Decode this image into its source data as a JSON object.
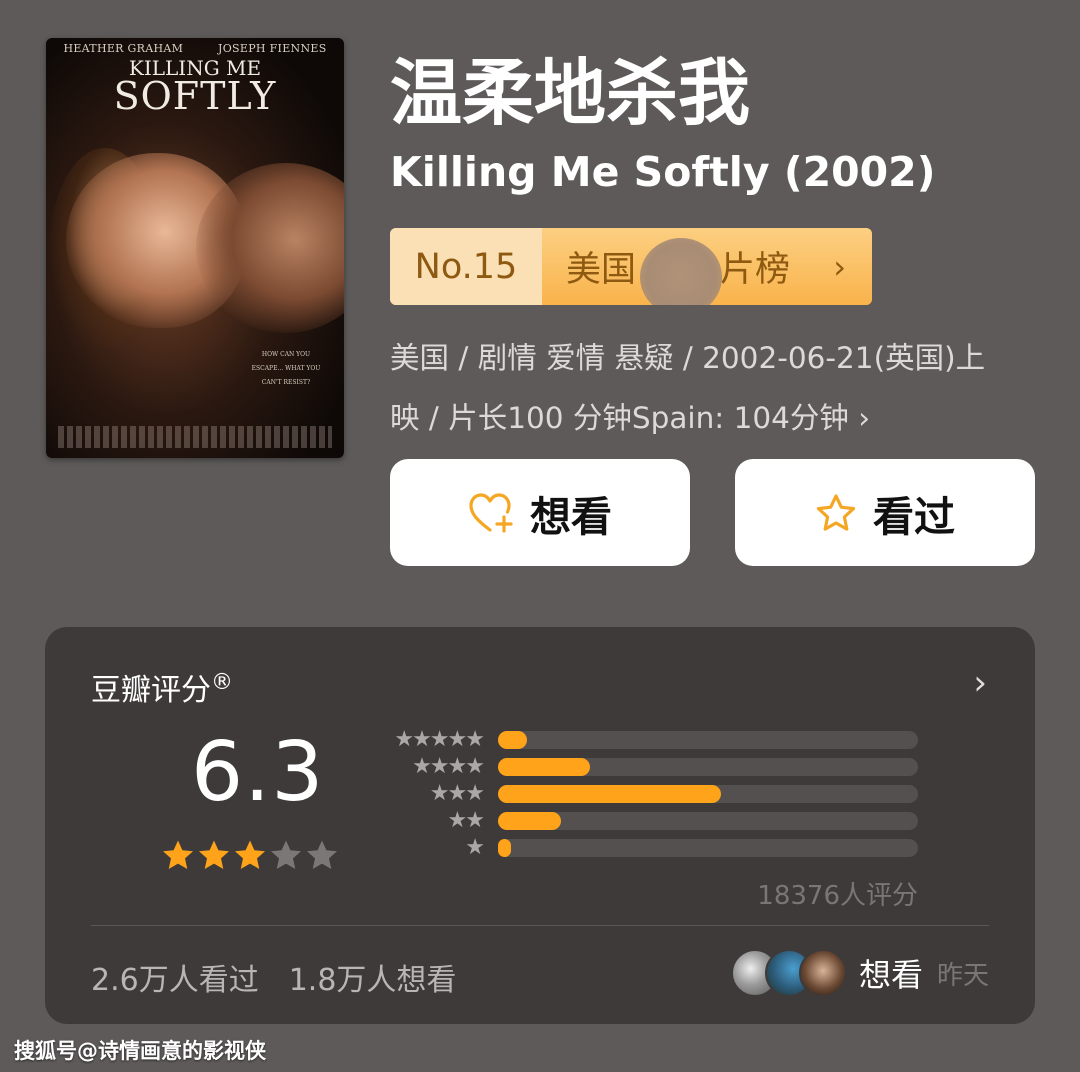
{
  "poster": {
    "actor_left": "HEATHER GRAHAM",
    "actor_right": "JOSEPH FIENNES",
    "title_line1": "KILLING ME",
    "title_line2": "SOFTLY",
    "tagline": "HOW CAN YOU ESCAPE... WHAT YOU CAN'T RESIST?"
  },
  "movie": {
    "title_cn": "温柔地杀我",
    "title_en": "Killing Me Softly (2002)",
    "rank_no": "No.15",
    "rank_list_visible": "美国",
    "rank_list_suffix": "片榜",
    "meta_line1": "美国 / 剧情 爱情 悬疑 / 2002-06-21(英国)上",
    "meta_line2": "映 / 片长100 分钟Spain: 104分钟 ›"
  },
  "actions": {
    "want_label": "想看",
    "seen_label": "看过"
  },
  "rating": {
    "section_title": "豆瓣评分",
    "registered_mark": "®",
    "score": "6.3",
    "stars_filled": 3,
    "stars_total": 5,
    "distribution": [
      {
        "stars": 5,
        "fraction": 0.07
      },
      {
        "stars": 4,
        "fraction": 0.22
      },
      {
        "stars": 3,
        "fraction": 0.53
      },
      {
        "stars": 2,
        "fraction": 0.15
      },
      {
        "stars": 1,
        "fraction": 0.03
      }
    ],
    "rating_count": "18376人评分",
    "watched_count": "2.6万人看过",
    "want_count": "1.8万人想看",
    "friend_action": "想看",
    "friend_time": "昨天"
  },
  "colors": {
    "accent": "#ffa31a",
    "badge_light": "#fce0b5",
    "badge_dark": "#8e5a12",
    "card_bg": "#3e3a3a",
    "page_bg": "#5e5a5a"
  },
  "watermark": "搜狐号@诗情画意的影视侠"
}
